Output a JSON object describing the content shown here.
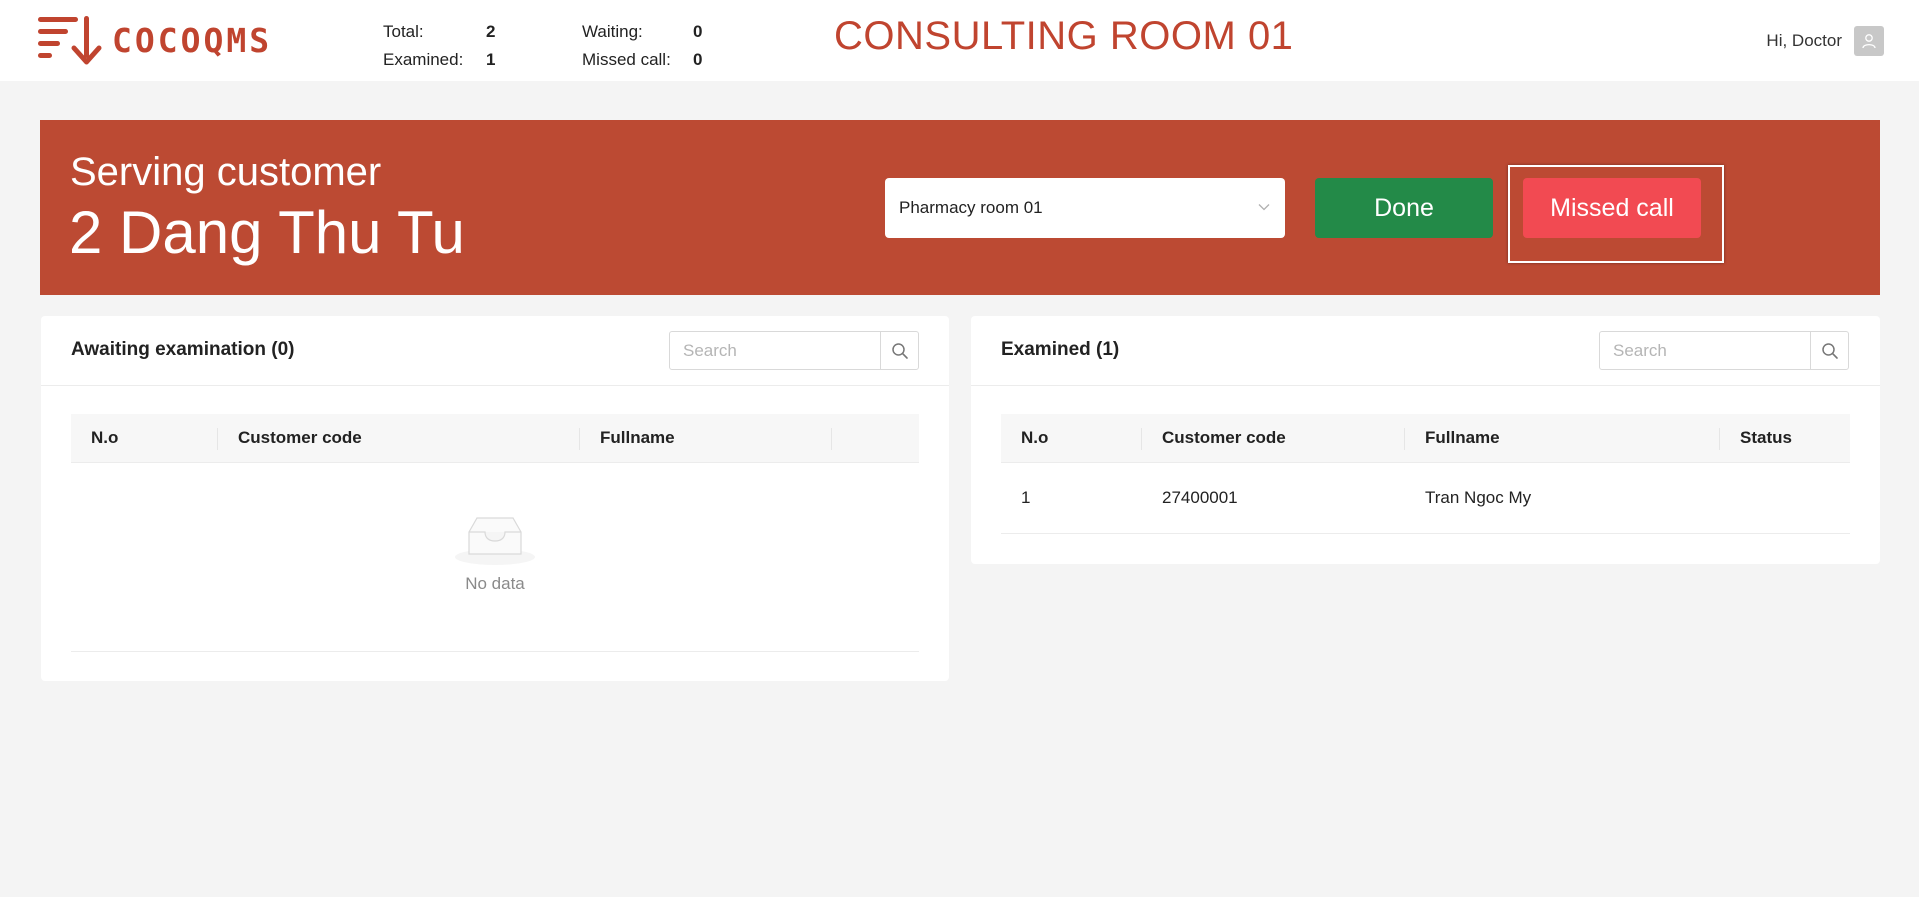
{
  "header": {
    "logo_text": "COCOQMS",
    "stats": {
      "total_label": "Total:",
      "total_value": "2",
      "examined_label": "Examined:",
      "examined_value": "1",
      "waiting_label": "Waiting:",
      "waiting_value": "0",
      "missed_label": "Missed call:",
      "missed_value": "0"
    },
    "room_title": "CONSULTING ROOM 01",
    "greeting": "Hi, Doctor",
    "avatar_icon": "user-icon"
  },
  "banner": {
    "serving_label": "Serving customer",
    "serving_name": "2 Dang Thu Tu",
    "room_select_value": "Pharmacy room 01",
    "done_label": "Done",
    "missed_label": "Missed call",
    "colors": {
      "banner": "#bc4a33",
      "done": "#238a48",
      "missed": "#f24a52"
    }
  },
  "awaiting": {
    "title": "Awaiting examination (0)",
    "search_placeholder": "Search",
    "columns": [
      "N.o",
      "Customer code",
      "Fullname",
      ""
    ],
    "rows": [],
    "empty_text": "No data"
  },
  "examined": {
    "title": "Examined (1)",
    "search_placeholder": "Search",
    "columns": [
      "N.o",
      "Customer code",
      "Fullname",
      "Status"
    ],
    "rows": [
      {
        "no": "1",
        "code": "27400001",
        "fullname": "Tran Ngoc My",
        "status": ""
      }
    ]
  }
}
